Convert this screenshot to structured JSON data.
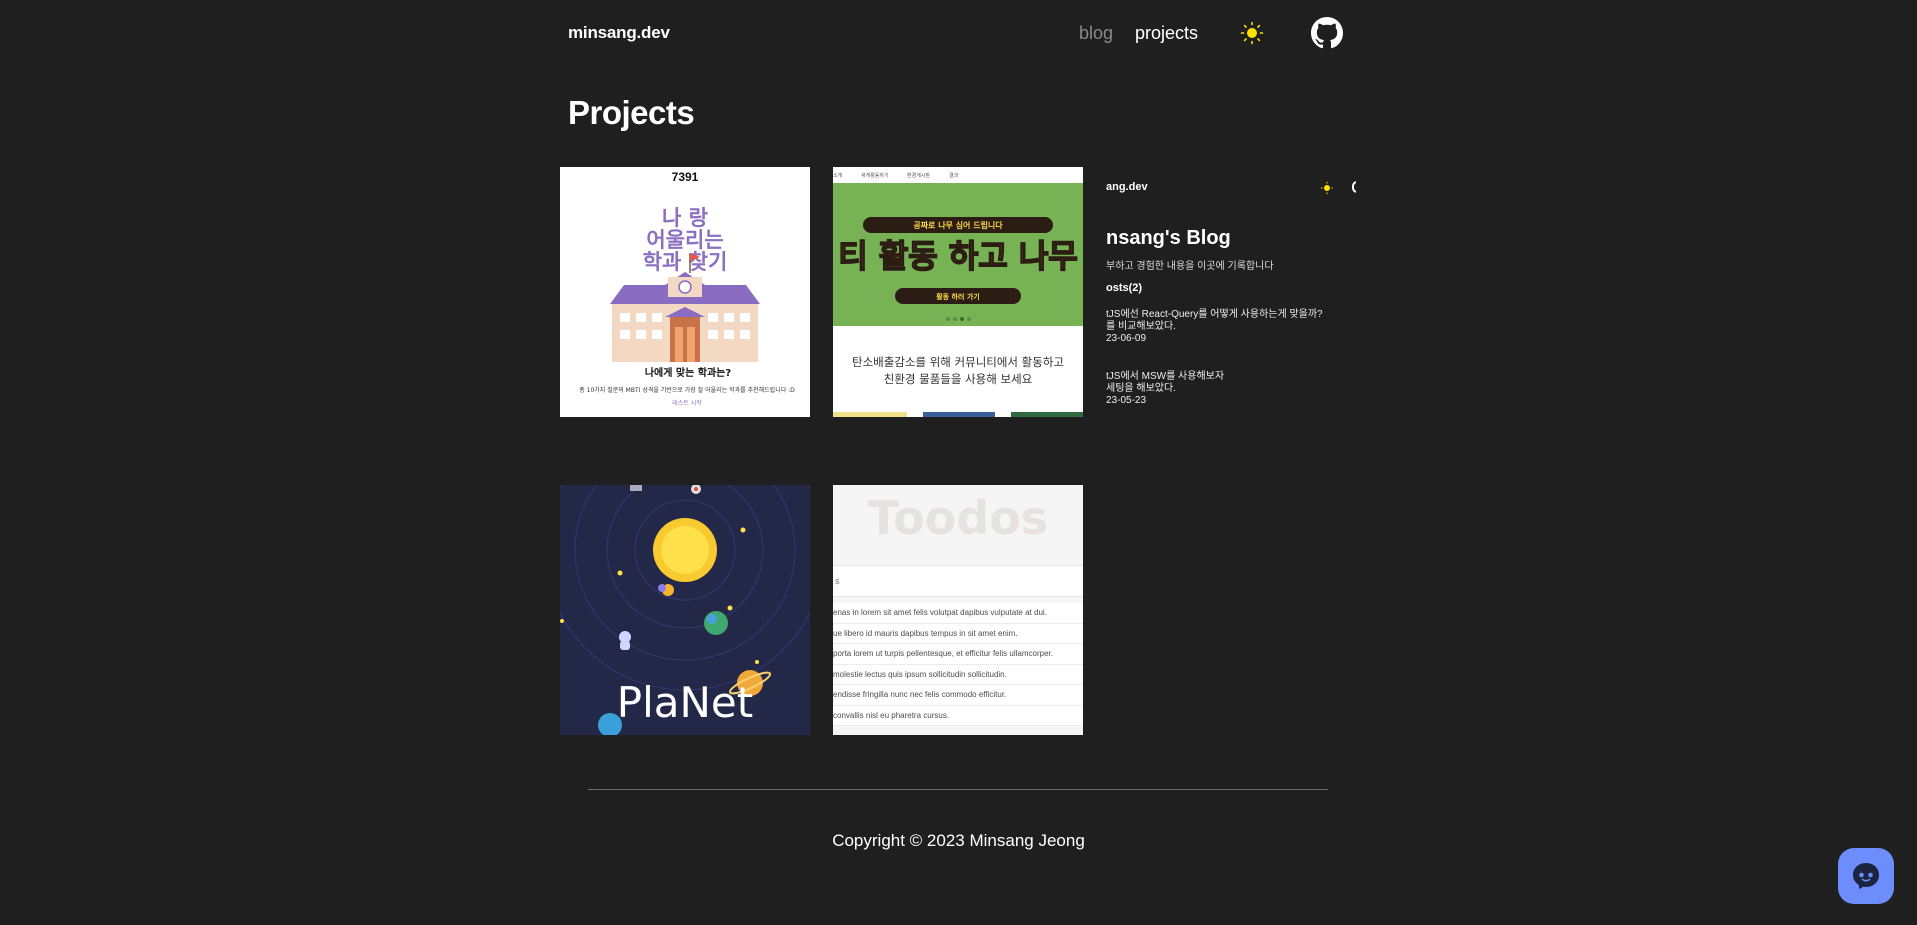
{
  "header": {
    "logo": "minsang.dev",
    "nav": {
      "blog": "blog",
      "projects": "projects"
    }
  },
  "page": {
    "title": "Projects"
  },
  "projects": [
    {
      "id": "major-finder",
      "top_number": "7391",
      "title_lines": [
        "나 랑",
        "어울리는",
        "학과 찾기"
      ],
      "question": "나에게 맞는 학과는?",
      "desc": "총 10가지 질문의 MBTI 성격을 기반으로 가장 잘 어울리는 학과를 추천해드립니다 :D",
      "start": "테스트 시작"
    },
    {
      "id": "tree-planting",
      "nav_items": [
        "소개",
        "새게활동하기",
        "환경게시판",
        "결과"
      ],
      "banner_small": "공짜로 나무 심어 드립니다",
      "banner_big": "티 활동 하고 나무",
      "banner_button": "활동 하러 가기",
      "caption_line1": "탄소배출감소를 위해 커뮤니티에서 활동하고",
      "caption_line2": "친환경 물품들을 사용해 보세요"
    },
    {
      "id": "blog",
      "logo": "ang.dev",
      "title": "nsang's Blog",
      "subtitle": "부하고 경험한 내용을 이곳에 기록합니다",
      "posts_label": "osts(2)",
      "posts": [
        {
          "line1": "tJS에선 React-Query를 어떻게 사용하는게 맞을까?",
          "line2": "를 비교해보았다.",
          "date": "23-06-09"
        },
        {
          "line1": "tJS에서 MSW를 사용해보자",
          "line2": "세팅을 해보았다.",
          "date": "23-05-23"
        }
      ]
    },
    {
      "id": "planet",
      "title": "PlaNet"
    },
    {
      "id": "todos",
      "title": "Toodos",
      "input_value": "s",
      "items": [
        "enas in lorem sit amet felis volutpat dapibus vulputate at dui.",
        "ue libero id mauris dapibus tempus in sit amet enim.",
        "porta lorem ut turpis pellentesque, et efficitur felis ullamcorper.",
        "molestie lectus quis ipsum sollicitudin sollicitudin.",
        "endisse fringilla nunc nec felis commodo efficitur.",
        "convallis nisl eu pharetra cursus."
      ]
    }
  ],
  "footer": {
    "copyright": "Copyright © 2023 Minsang Jeong"
  },
  "colors": {
    "background": "#1f1f1f",
    "accent_sun": "#fde100",
    "chat_button": "#6c8dfb"
  },
  "icons": {
    "theme": "sun-icon",
    "github": "github-icon",
    "chat": "chat-bot-icon"
  }
}
